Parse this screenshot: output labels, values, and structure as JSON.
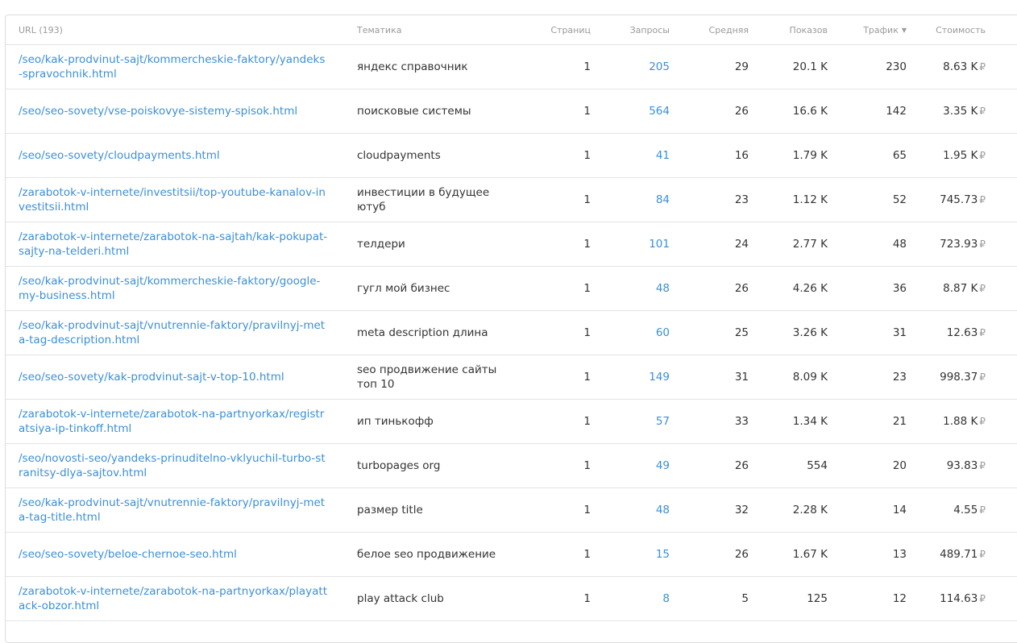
{
  "headers": {
    "url": "URL (193)",
    "topic": "Тематика",
    "pages": "Страниц",
    "requests": "Запросы",
    "average": "Средняя",
    "shows": "Показов",
    "traffic": "Трафик",
    "cost": "Стоимость"
  },
  "sort_indicator_icon": "caret-down-icon",
  "currency_symbol": "₽",
  "colors": {
    "link": "#3a8fd9",
    "text": "#333333",
    "header_text": "#9a9a9a",
    "border": "#e4e4e4"
  },
  "rows": [
    {
      "url": "/seo/kak-prodvinut-sajt/kommercheskie-faktory/yandeks-spravochnik.html",
      "topic": "яндекс справочник",
      "pages": "1",
      "requests": "205",
      "average": "29",
      "shows": "20.1 K",
      "traffic": "230",
      "cost": "8.63 K"
    },
    {
      "url": "/seo/seo-sovety/vse-poiskovye-sistemy-spisok.html",
      "topic": "поисковые системы",
      "pages": "1",
      "requests": "564",
      "average": "26",
      "shows": "16.6 K",
      "traffic": "142",
      "cost": "3.35 K"
    },
    {
      "url": "/seo/seo-sovety/cloudpayments.html",
      "topic": "cloudpayments",
      "pages": "1",
      "requests": "41",
      "average": "16",
      "shows": "1.79 K",
      "traffic": "65",
      "cost": "1.95 K"
    },
    {
      "url": "/zarabotok-v-internete/investitsii/top-youtube-kanalov-investitsii.html",
      "topic": "инвестиции в будущее ютуб",
      "pages": "1",
      "requests": "84",
      "average": "23",
      "shows": "1.12 K",
      "traffic": "52",
      "cost": "745.73"
    },
    {
      "url": "/zarabotok-v-internete/zarabotok-na-sajtah/kak-pokupat-sajty-na-telderi.html",
      "topic": "телдери",
      "pages": "1",
      "requests": "101",
      "average": "24",
      "shows": "2.77 K",
      "traffic": "48",
      "cost": "723.93"
    },
    {
      "url": "/seo/kak-prodvinut-sajt/kommercheskie-faktory/google-my-business.html",
      "topic": "гугл мой бизнес",
      "pages": "1",
      "requests": "48",
      "average": "26",
      "shows": "4.26 K",
      "traffic": "36",
      "cost": "8.87 K"
    },
    {
      "url": "/seo/kak-prodvinut-sajt/vnutrennie-faktory/pravilnyj-meta-tag-description.html",
      "topic": "meta description длина",
      "pages": "1",
      "requests": "60",
      "average": "25",
      "shows": "3.26 K",
      "traffic": "31",
      "cost": "12.63"
    },
    {
      "url": "/seo/seo-sovety/kak-prodvinut-sajt-v-top-10.html",
      "topic": "seo продвижение сайты топ 10",
      "pages": "1",
      "requests": "149",
      "average": "31",
      "shows": "8.09 K",
      "traffic": "23",
      "cost": "998.37"
    },
    {
      "url": "/zarabotok-v-internete/zarabotok-na-partnyorkax/registratsiya-ip-tinkoff.html",
      "topic": "ип тинькофф",
      "pages": "1",
      "requests": "57",
      "average": "33",
      "shows": "1.34 K",
      "traffic": "21",
      "cost": "1.88 K"
    },
    {
      "url": "/seo/novosti-seo/yandeks-prinuditelno-vklyuchil-turbo-stranitsy-dlya-sajtov.html",
      "topic": "turbopages org",
      "pages": "1",
      "requests": "49",
      "average": "26",
      "shows": "554",
      "traffic": "20",
      "cost": "93.83"
    },
    {
      "url": "/seo/kak-prodvinut-sajt/vnutrennie-faktory/pravilnyj-meta-tag-title.html",
      "topic": "размер title",
      "pages": "1",
      "requests": "48",
      "average": "32",
      "shows": "2.28 K",
      "traffic": "14",
      "cost": "4.55"
    },
    {
      "url": "/seo/seo-sovety/beloe-chernoe-seo.html",
      "topic": "белое seo продвижение",
      "pages": "1",
      "requests": "15",
      "average": "26",
      "shows": "1.67 K",
      "traffic": "13",
      "cost": "489.71"
    },
    {
      "url": "/zarabotok-v-internete/zarabotok-na-partnyorkax/playattack-obzor.html",
      "topic": "play attack club",
      "pages": "1",
      "requests": "8",
      "average": "5",
      "shows": "125",
      "traffic": "12",
      "cost": "114.63"
    }
  ]
}
